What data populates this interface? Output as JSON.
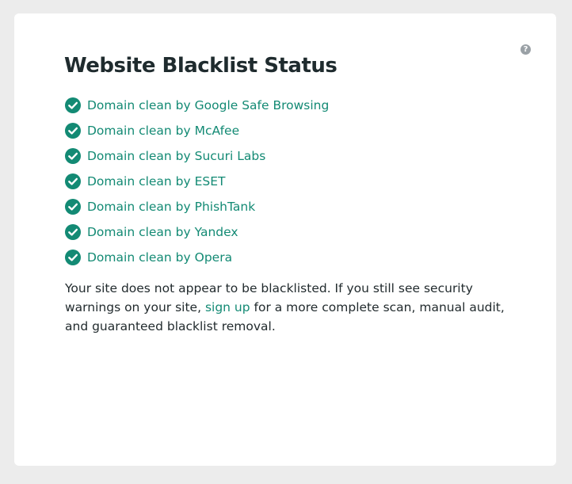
{
  "panel": {
    "title": "Website Blacklist Status",
    "help_icon": "question-circle-icon",
    "help_glyph": "?"
  },
  "status_items": [
    {
      "label": "Domain clean by Google Safe Browsing",
      "icon": "check-circle-icon"
    },
    {
      "label": "Domain clean by McAfee",
      "icon": "check-circle-icon"
    },
    {
      "label": "Domain clean by Sucuri Labs",
      "icon": "check-circle-icon"
    },
    {
      "label": "Domain clean by ESET",
      "icon": "check-circle-icon"
    },
    {
      "label": "Domain clean by PhishTank",
      "icon": "check-circle-icon"
    },
    {
      "label": "Domain clean by Yandex",
      "icon": "check-circle-icon"
    },
    {
      "label": "Domain clean by Opera",
      "icon": "check-circle-icon"
    }
  ],
  "summary": {
    "before_link": "Your site does not appear to be blacklisted. If you still see security warnings on your site, ",
    "link_text": "sign up",
    "after_link": " for a more complete scan, manual audit, and guaranteed blacklist removal."
  },
  "colors": {
    "accent": "#138a74",
    "heading": "#1f2b2e",
    "body_text": "#222b2e",
    "background": "#ececec",
    "card": "#ffffff",
    "help_icon": "#9aa1a6"
  }
}
